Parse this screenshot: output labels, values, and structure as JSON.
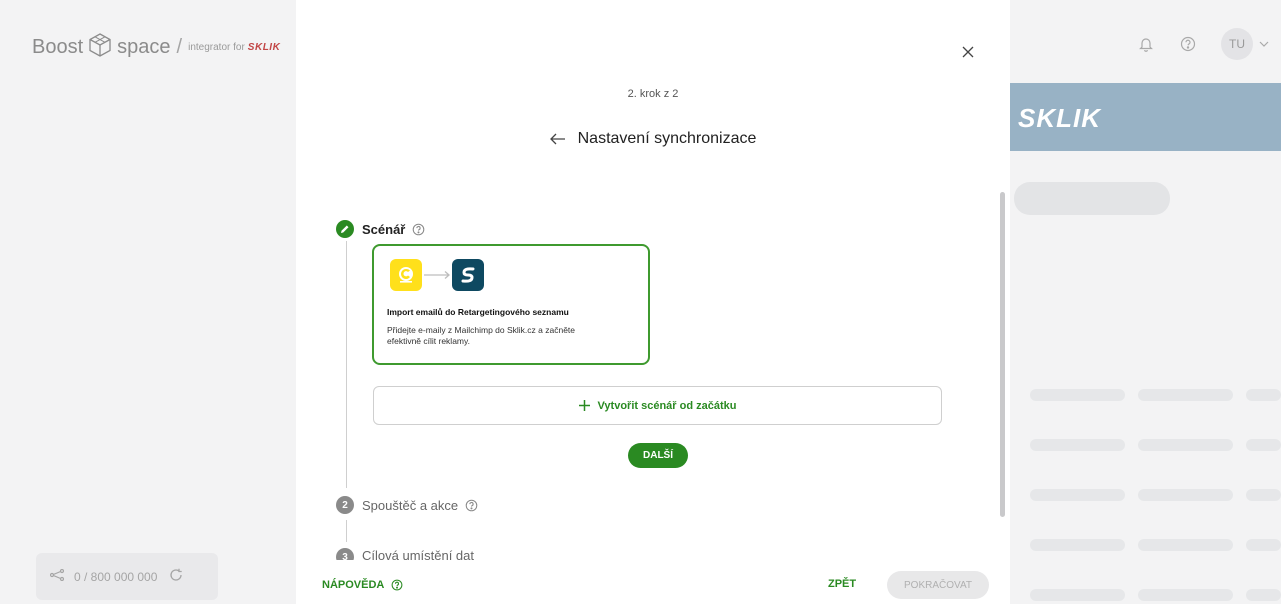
{
  "brand": {
    "name_part1": "Boost",
    "name_part2": "space",
    "slash": "/",
    "integrator_label": "integrator for",
    "partner": "SKLIK"
  },
  "sidebar": {
    "operations": "0 / 800 000 000"
  },
  "header": {
    "avatar_initials": "TU"
  },
  "background": {
    "banner_text": "SKLIK"
  },
  "modal": {
    "step_indicator": "2. krok z 2",
    "title": "Nastavení synchronizace",
    "steps": [
      {
        "number": "1",
        "label": "Scénář",
        "state": "done"
      },
      {
        "number": "2",
        "label": "Spouštěč a akce",
        "state": "todo"
      },
      {
        "number": "3",
        "label": "Cílová umístění dat",
        "state": "todo"
      }
    ],
    "scenario_card": {
      "title": "Import emailů do Retargetingového seznamu",
      "description": "Přidejte e-maily z Mailchimp do Sklik.cz a začněte efektivně cílit reklamy.",
      "source_app": "mailchimp-logo",
      "target_app": "sklik-logo"
    },
    "create_button_label": "Vytvořit scénář od začátku",
    "next_button_label": "DALŠÍ",
    "footer": {
      "help_label": "NÁPOVĚDA",
      "back_label": "ZPĚT",
      "continue_label": "POKRAČOVAT"
    }
  },
  "colors": {
    "accent_green": "#2a8a22",
    "sklik_blue": "#0e4961",
    "mailchimp_yellow": "#ffe01b",
    "banner_blue": "#98b2c5"
  }
}
